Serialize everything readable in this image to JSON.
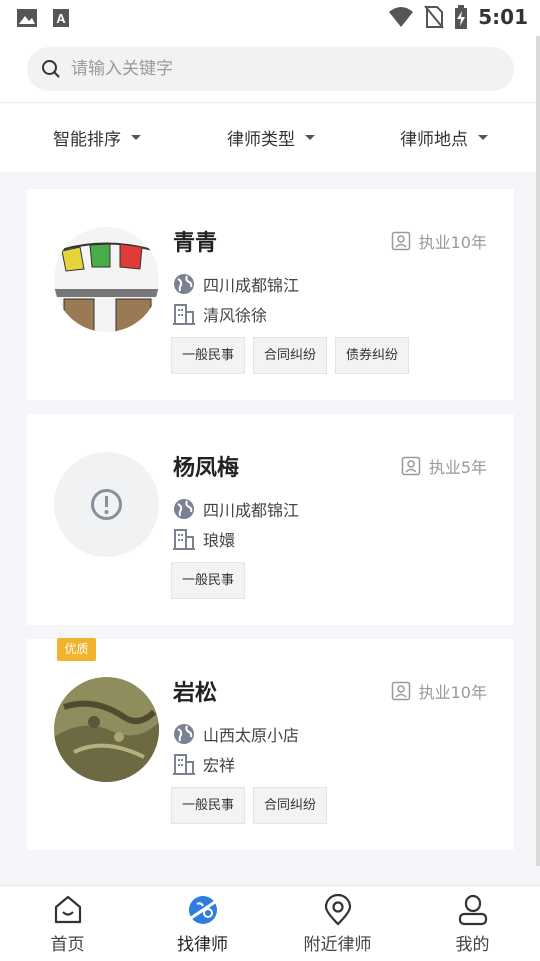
{
  "status_bar": {
    "time": "5:01",
    "icons": [
      "image-icon",
      "font-a-icon",
      "wifi-icon",
      "no-sim-icon",
      "battery-charging-icon"
    ]
  },
  "search": {
    "placeholder": "请输入关键字",
    "value": ""
  },
  "filters": [
    {
      "label": "智能排序"
    },
    {
      "label": "律师类型"
    },
    {
      "label": "律师地点"
    }
  ],
  "lawyers": [
    {
      "name": "青青",
      "years": "执业10年",
      "location": "四川成都锦江",
      "firm": "清风徐徐",
      "tags": [
        "一般民事",
        "合同纠纷",
        "债券纠纷"
      ],
      "badge": "",
      "avatar": "flags-icon"
    },
    {
      "name": "杨凤梅",
      "years": "执业5年",
      "location": "四川成都锦江",
      "firm": "琅嬛",
      "tags": [
        "一般民事"
      ],
      "badge": "",
      "avatar": "alert-placeholder-icon"
    },
    {
      "name": "岩松",
      "years": "执业10年",
      "location": "山西太原小店",
      "firm": "宏祥",
      "tags": [
        "一般民事",
        "合同纠纷"
      ],
      "badge": "优质",
      "avatar": "crocodile-photo"
    }
  ],
  "nav": [
    {
      "label": "首页",
      "icon": "home-icon"
    },
    {
      "label": "找律师",
      "icon": "find-lawyer-icon",
      "active": true
    },
    {
      "label": "附近律师",
      "icon": "location-pin-icon"
    },
    {
      "label": "我的",
      "icon": "profile-icon"
    }
  ],
  "colors": {
    "accent": "#2f7de1",
    "badge": "#f1b22e",
    "background": "#f5f6fa"
  }
}
